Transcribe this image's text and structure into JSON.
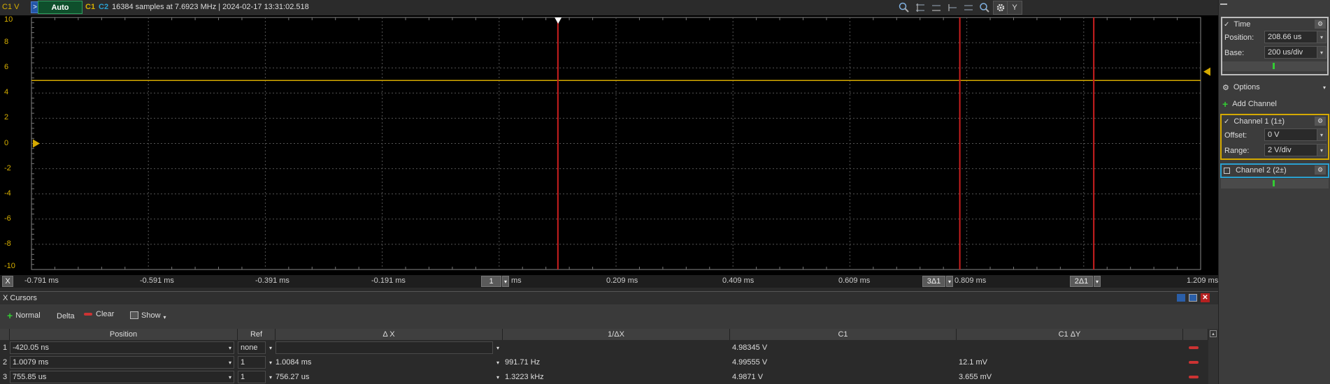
{
  "toolbar": {
    "channel_unit": "C1 V",
    "trigger_mode": "Auto",
    "ch1_label": "C1",
    "ch2_label": "C2",
    "acquisition_info": "16384 samples at 7.6923 MHz | 2024-02-17 13:31:02.518",
    "icons": [
      "zoom-icon",
      "cursor-h-icon",
      "cursor-v-icon",
      "cursor-left-icon",
      "cursor-right-icon",
      "search-icon",
      "gear-icon"
    ],
    "y_button": "Y"
  },
  "plot": {
    "y_ticks": [
      "10",
      "8",
      "6",
      "4",
      "2",
      "0",
      "-2",
      "-4",
      "-6",
      "-8",
      "-10"
    ],
    "x_ticks": [
      "-0.791 ms",
      "-0.591 ms",
      "-0.391 ms",
      "-0.191 ms",
      "0.209 ms",
      "0.409 ms",
      "0.609 ms",
      "0.809 ms",
      "1.209 ms"
    ],
    "x_button": "X",
    "cursor1_label": "1",
    "cursor1_unit": "ms",
    "cursor3_label": "3Δ1",
    "cursor2_label": "2Δ1",
    "trace_color": "#d4a900",
    "cursor_color": "#cc1f1f"
  },
  "time_panel": {
    "title": "Time",
    "position_label": "Position:",
    "position_value": "208.66 us",
    "base_label": "Base:",
    "base_value": "200 us/div"
  },
  "options": {
    "label": "Options"
  },
  "add_channel": {
    "label": "Add Channel"
  },
  "channel1": {
    "title": "Channel 1 (1±)",
    "offset_label": "Offset:",
    "offset_value": "0 V",
    "range_label": "Range:",
    "range_value": "2 V/div",
    "color": "#d4a900"
  },
  "channel2": {
    "title": "Channel 2 (2±)",
    "color": "#2aa0d0"
  },
  "cursors": {
    "title": "X Cursors",
    "normal_label": "Normal",
    "delta_label": "Delta",
    "clear_label": "Clear",
    "show_label": "Show",
    "columns": [
      "Position",
      "Ref",
      "Δ X",
      "1/ΔX",
      "C1",
      "C1 ΔY"
    ],
    "rows": [
      {
        "num": "1",
        "position": "-420.05 ns",
        "ref": "none",
        "dx": "",
        "inv_dx": "",
        "c1": "4.98345 V",
        "c1_dy": ""
      },
      {
        "num": "2",
        "position": "1.0079 ms",
        "ref": "1",
        "dx": "1.0084 ms",
        "inv_dx": "991.71 Hz",
        "c1": "4.99555 V",
        "c1_dy": "12.1 mV"
      },
      {
        "num": "3",
        "position": "755.85 us",
        "ref": "1",
        "dx": "756.27 us",
        "inv_dx": "1.3223 kHz",
        "c1": "4.9871 V",
        "c1_dy": "3.655 mV"
      }
    ]
  }
}
